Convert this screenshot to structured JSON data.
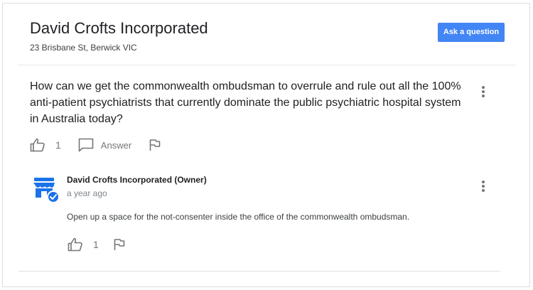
{
  "business": {
    "name": "David Crofts Incorporated",
    "address": "23 Brisbane St, Berwick VIC"
  },
  "actions": {
    "ask_question_label": "Ask a question"
  },
  "question": {
    "text": "How can we get the commonwealth ombudsman to overrule and rule out all the 100% anti-patient psychiatrists that currently dominate the public psychiatric hospital system in Australia today?",
    "like_count": "1",
    "answer_label": "Answer"
  },
  "answer": {
    "author": "David Crofts Incorporated (Owner)",
    "time": "a year ago",
    "text": "Open up a space for the not-consenter inside the office of the commonwealth ombudsman.",
    "like_count": "1"
  },
  "colors": {
    "accent": "#4285f4",
    "icon_grey": "#757575",
    "owner_badge": "#1a73e8"
  },
  "icons": {
    "like": "thumbs-up-icon",
    "answer": "comment-icon",
    "flag": "flag-icon",
    "more": "more-vertical-icon",
    "avatar": "storefront-verified-icon"
  }
}
